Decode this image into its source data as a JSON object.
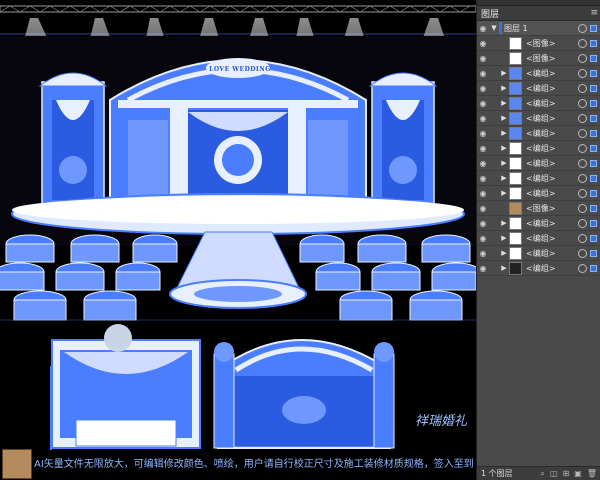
{
  "canvas": {
    "logo_text": "LOVE WEDDING",
    "caption": "AI矢量文件无限放大，可编辑修改颜色、喷绘，用户请自行校正尺寸及施工装修材质规格，签入至到",
    "signature": "祥瑞婚礼"
  },
  "layers_panel": {
    "tab_label": "图层",
    "menu_icon": "panel-menu-icon",
    "top_layer": {
      "name": "图层 1"
    },
    "rows": [
      {
        "name": "<图像>",
        "has_arrow": false,
        "thumb": "white"
      },
      {
        "name": "<图像>",
        "has_arrow": false,
        "thumb": "white"
      },
      {
        "name": "<编组>",
        "has_arrow": true,
        "thumb": "blue"
      },
      {
        "name": "<编组>",
        "has_arrow": true,
        "thumb": "blue"
      },
      {
        "name": "<编组>",
        "has_arrow": true,
        "thumb": "blue"
      },
      {
        "name": "<编组>",
        "has_arrow": true,
        "thumb": "blue"
      },
      {
        "name": "<编组>",
        "has_arrow": true,
        "thumb": "blue"
      },
      {
        "name": "<编组>",
        "has_arrow": true,
        "thumb": "white"
      },
      {
        "name": "<编组>",
        "has_arrow": true,
        "thumb": "white"
      },
      {
        "name": "<编组>",
        "has_arrow": true,
        "thumb": "white"
      },
      {
        "name": "<编组>",
        "has_arrow": true,
        "thumb": "white"
      },
      {
        "name": "<图像>",
        "has_arrow": false,
        "thumb": "photo"
      },
      {
        "name": "<编组>",
        "has_arrow": true,
        "thumb": "white"
      },
      {
        "name": "<编组>",
        "has_arrow": true,
        "thumb": "white"
      },
      {
        "name": "<编组>",
        "has_arrow": true,
        "thumb": "white"
      },
      {
        "name": "<编组>",
        "has_arrow": true,
        "thumb": "dark"
      }
    ],
    "footer": {
      "layer_count": "1 个图层"
    }
  },
  "colors": {
    "structure_blue": "#4a7dff",
    "structure_light": "#e8efff",
    "selection_blue": "#3a73d8",
    "panel_bg": "#4a4a4a"
  }
}
